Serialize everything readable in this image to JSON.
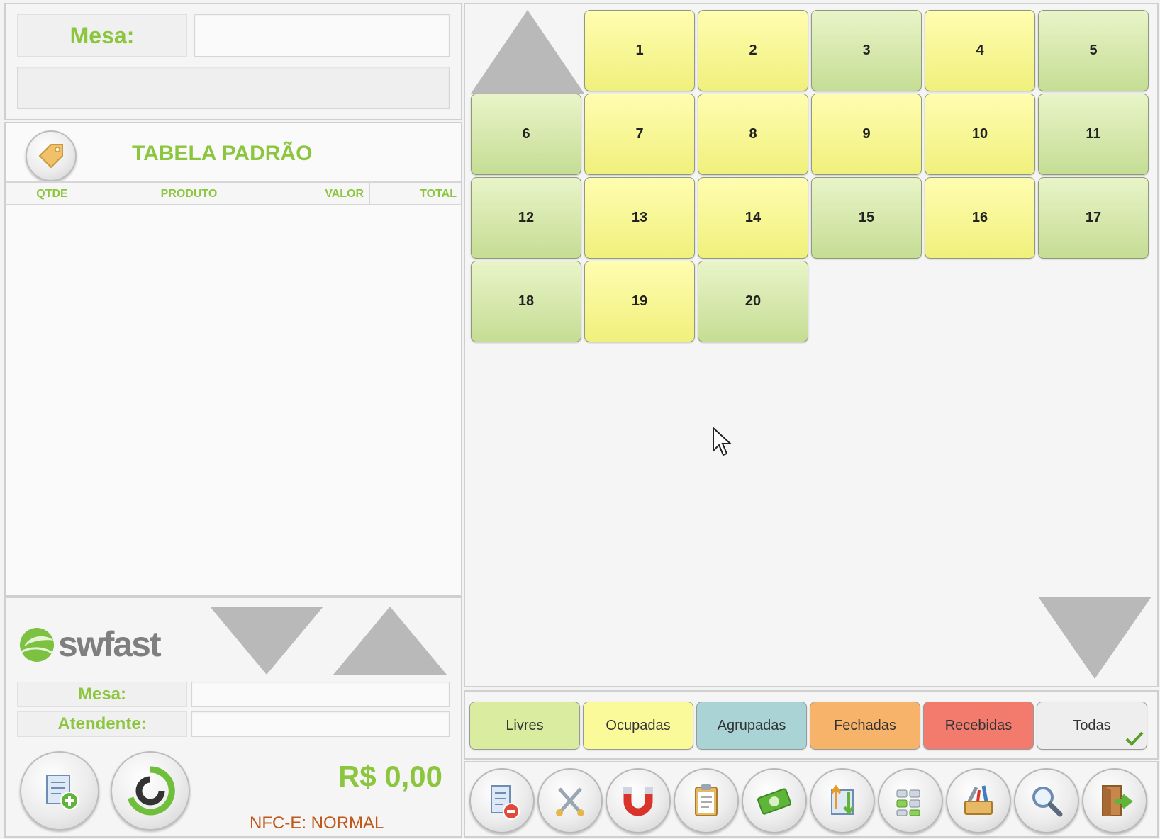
{
  "left_panel": {
    "mesa_label": "Mesa:",
    "mesa_value": "",
    "mesa_subfield": "",
    "price_table_title": "TABELA PADRÃO",
    "columns": [
      "QTDE",
      "PRODUTO",
      "VALOR",
      "TOTAL"
    ],
    "items": [],
    "logo_text": "swfast",
    "footer_mesa_label": "Mesa:",
    "footer_mesa_value": "",
    "footer_atendente_label": "Atendente:",
    "footer_atendente_value": "",
    "total": "R$ 0,00",
    "nfce_status": "NFC-E: NORMAL"
  },
  "tables": [
    {
      "number": "1",
      "status": "ocupada"
    },
    {
      "number": "2",
      "status": "ocupada"
    },
    {
      "number": "3",
      "status": "livre"
    },
    {
      "number": "4",
      "status": "ocupada"
    },
    {
      "number": "5",
      "status": "livre"
    },
    {
      "number": "6",
      "status": "livre"
    },
    {
      "number": "7",
      "status": "ocupada"
    },
    {
      "number": "8",
      "status": "ocupada"
    },
    {
      "number": "9",
      "status": "ocupada"
    },
    {
      "number": "10",
      "status": "ocupada"
    },
    {
      "number": "11",
      "status": "livre"
    },
    {
      "number": "12",
      "status": "livre"
    },
    {
      "number": "13",
      "status": "ocupada"
    },
    {
      "number": "14",
      "status": "ocupada"
    },
    {
      "number": "15",
      "status": "livre"
    },
    {
      "number": "16",
      "status": "ocupada"
    },
    {
      "number": "17",
      "status": "livre"
    },
    {
      "number": "18",
      "status": "livre"
    },
    {
      "number": "19",
      "status": "ocupada"
    },
    {
      "number": "20",
      "status": "livre"
    }
  ],
  "filters": [
    {
      "label": "Livres",
      "color": "#d9ec9f"
    },
    {
      "label": "Ocupadas",
      "color": "#fbfa9a"
    },
    {
      "label": "Agrupadas",
      "color": "#a9d3d5"
    },
    {
      "label": "Fechadas",
      "color": "#f8b36b"
    },
    {
      "label": "Recebidas",
      "color": "#f27b6d"
    },
    {
      "label": "Todas",
      "color": "#eeeeee",
      "selected": true
    }
  ],
  "toolbar_icons": [
    "remove-order-icon",
    "utensils-icon",
    "magnet-icon",
    "clipboard-icon",
    "cash-icon",
    "transfer-icon",
    "tables-grid-icon",
    "tools-icon",
    "search-icon",
    "exit-door-icon"
  ],
  "colors": {
    "accent_green": "#8cc63f",
    "nfce_text": "#c0571b",
    "tile_yellow": "#f7f69a",
    "tile_green": "#d4e6aa"
  }
}
